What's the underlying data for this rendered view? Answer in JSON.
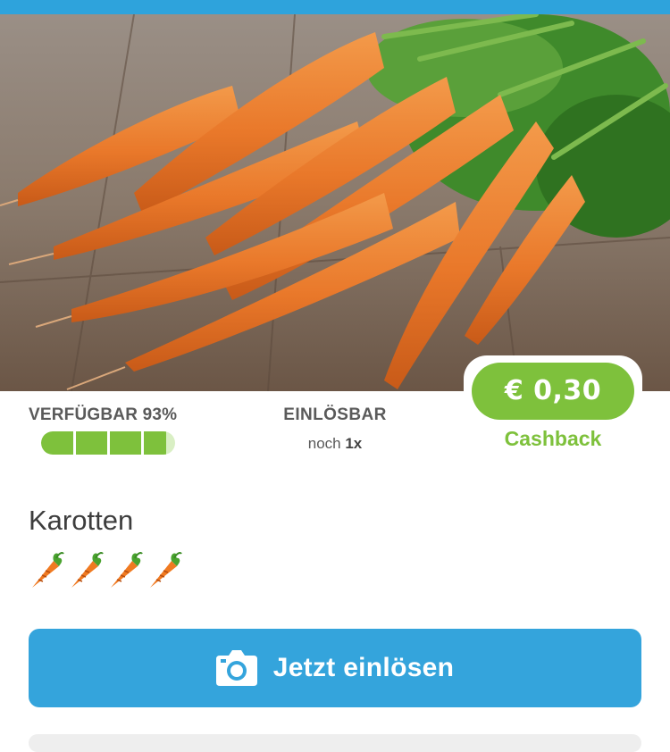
{
  "colors": {
    "accent_blue": "#34a4dc",
    "cashback_green": "#7ec13c",
    "text_gray": "#5a5a5a"
  },
  "hero": {
    "icon": "carrots-photo"
  },
  "availability": {
    "label": "VERFÜGBAR",
    "percent_text": "93%",
    "percent_value": 93
  },
  "redeemable": {
    "label": "EINLÖSBAR",
    "prefix": "noch",
    "count": "1x"
  },
  "cashback": {
    "amount": "€ 0,30",
    "label": "Cashback"
  },
  "product": {
    "title": "Karotten",
    "rating_icon": "carrot-icon",
    "rating_count": 4
  },
  "action": {
    "label": "Jetzt einlösen",
    "icon": "camera-icon"
  }
}
